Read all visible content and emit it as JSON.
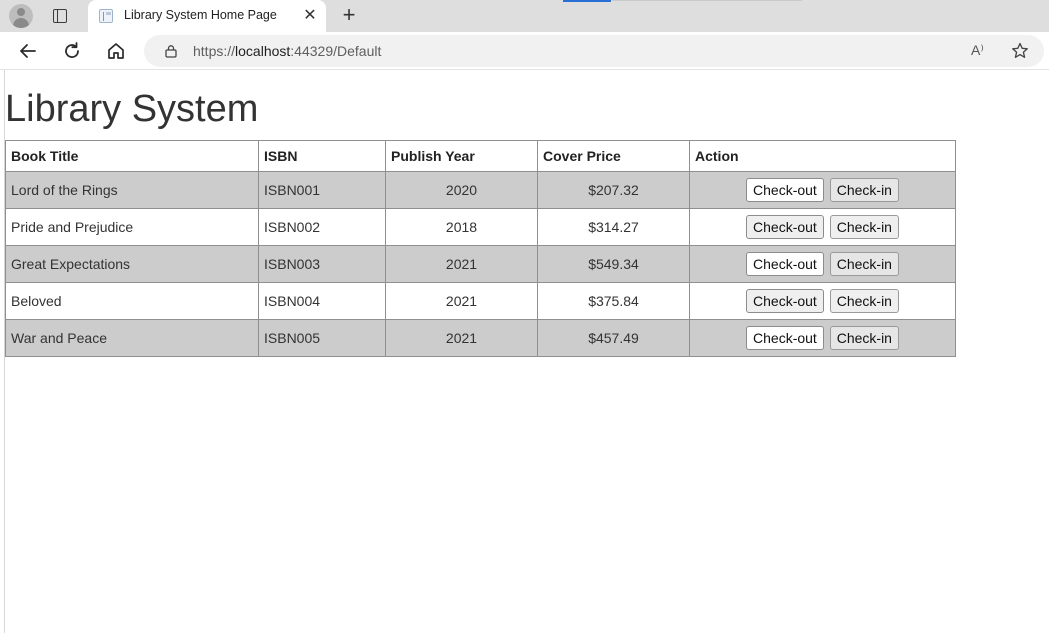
{
  "browser": {
    "tab_title": "Library System Home Page",
    "tab_close_glyph": "✕",
    "new_tab_glyph": "+",
    "url_prefix": "https://",
    "url_host": "localhost",
    "url_rest": ":44329/Default",
    "read_aloud_glyph": "A⁾"
  },
  "page": {
    "heading": "Library System"
  },
  "table": {
    "headers": [
      "Book Title",
      "ISBN",
      "Publish Year",
      "Cover Price",
      "Action"
    ],
    "rows": [
      {
        "title": "Lord of the Rings",
        "isbn": "ISBN001",
        "year": "2020",
        "price": "$207.32"
      },
      {
        "title": "Pride and Prejudice",
        "isbn": "ISBN002",
        "year": "2018",
        "price": "$314.27"
      },
      {
        "title": "Great Expectations",
        "isbn": "ISBN003",
        "year": "2021",
        "price": "$549.34"
      },
      {
        "title": "Beloved",
        "isbn": "ISBN004",
        "year": "2021",
        "price": "$375.84"
      },
      {
        "title": "War and Peace",
        "isbn": "ISBN005",
        "year": "2021",
        "price": "$457.49"
      }
    ],
    "checkout_label": "Check-out",
    "checkin_label": "Check-in",
    "stripe_color": "#cccccc"
  }
}
